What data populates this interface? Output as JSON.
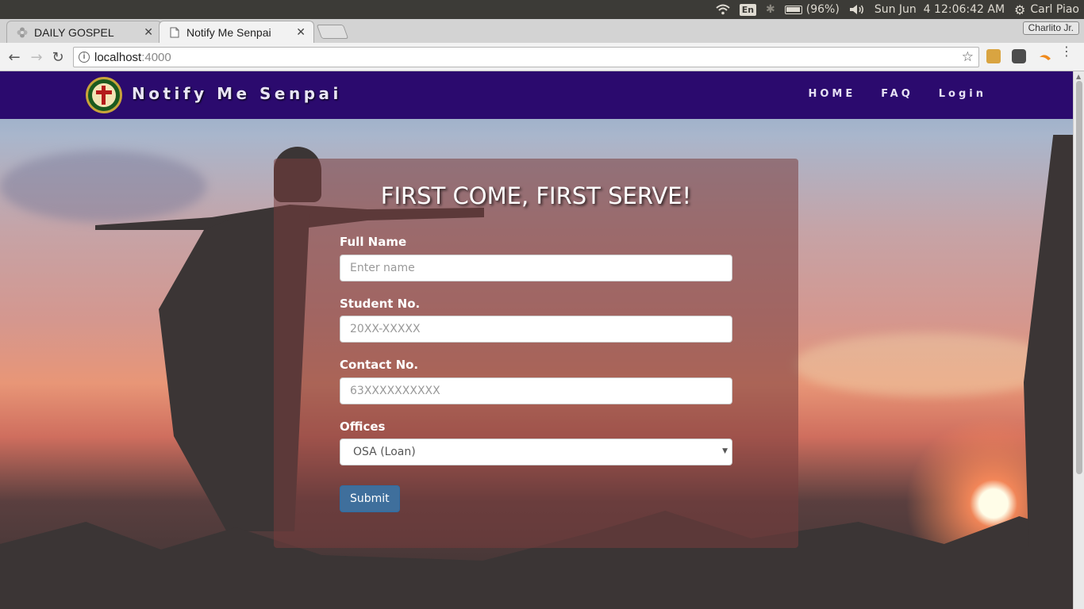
{
  "os_panel": {
    "battery": "(96%)",
    "lang": "En",
    "datetime": "Sun Jun  4 12:06:42 AM",
    "user": "Carl Piao"
  },
  "browser": {
    "tabs": [
      {
        "label": "DAILY GOSPEL",
        "active": false
      },
      {
        "label": "Notify Me Senpai",
        "active": true
      }
    ],
    "profile": "Charlito Jr.",
    "url_host": "localhost",
    "url_port": ":4000"
  },
  "site": {
    "brand": "Notify Me Senpai",
    "nav": [
      "HOME",
      "FAQ",
      "Login"
    ]
  },
  "form": {
    "title": "FIRST COME, FIRST SERVE!",
    "fields": [
      {
        "label": "Full Name",
        "placeholder": "Enter name",
        "value": ""
      },
      {
        "label": "Student No.",
        "placeholder": "20XX-XXXXX",
        "value": ""
      },
      {
        "label": "Contact No.",
        "placeholder": "63XXXXXXXXXX",
        "value": ""
      }
    ],
    "offices_label": "Offices",
    "offices_selected": "OSA (Loan)",
    "submit_label": "Submit"
  },
  "colors": {
    "navbar": "#2b0a6e",
    "button": "#3f6f9c"
  }
}
